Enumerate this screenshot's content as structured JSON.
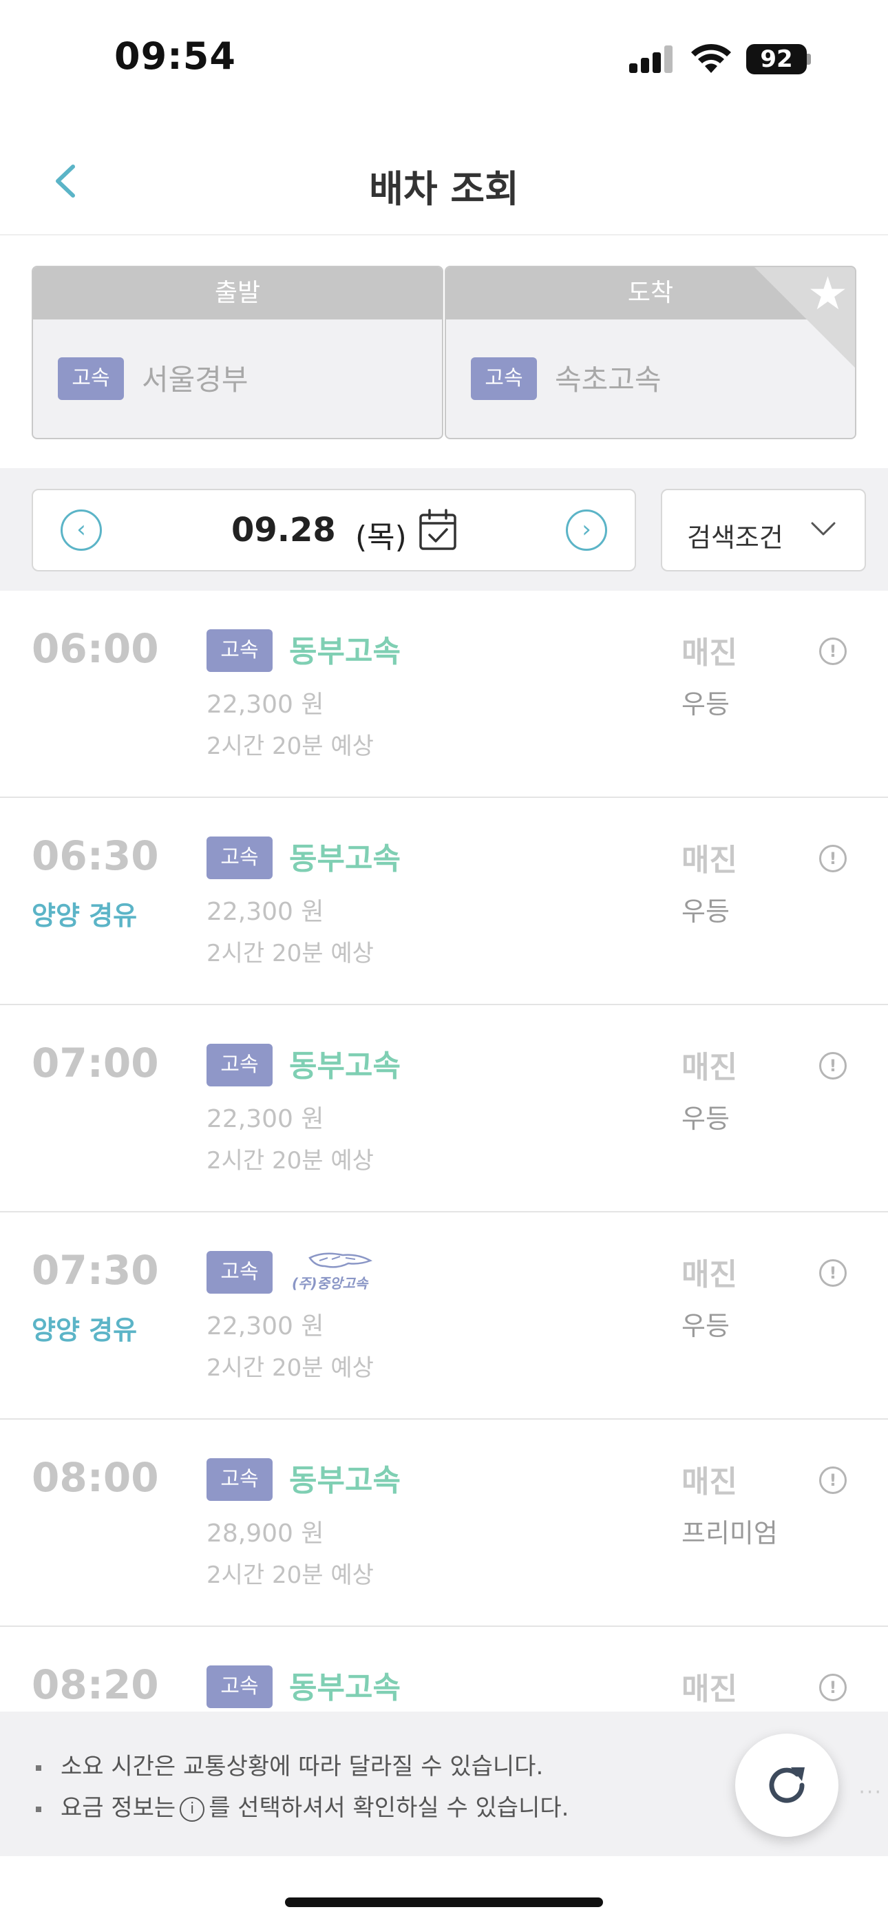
{
  "status_bar": {
    "time": "09:54",
    "battery": "92"
  },
  "header": {
    "title": "배차 조회"
  },
  "route": {
    "departure": {
      "label": "출발",
      "badge": "고속",
      "terminal": "서울경부"
    },
    "arrival": {
      "label": "도착",
      "badge": "고속",
      "terminal": "속초고속"
    }
  },
  "date_bar": {
    "date": "09.28",
    "weekday": "(목)",
    "search_label": "검색조건"
  },
  "buses": [
    {
      "time": "06:00",
      "via": "",
      "badge": "고속",
      "company": "동부고속",
      "price": "22,300 원",
      "duration": "2시간 20분 예상",
      "status": "매진",
      "grade": "우등"
    },
    {
      "time": "06:30",
      "via": "양양 경유",
      "badge": "고속",
      "company": "동부고속",
      "price": "22,300 원",
      "duration": "2시간 20분 예상",
      "status": "매진",
      "grade": "우등"
    },
    {
      "time": "07:00",
      "via": "",
      "badge": "고속",
      "company": "동부고속",
      "price": "22,300 원",
      "duration": "2시간 20분 예상",
      "status": "매진",
      "grade": "우등"
    },
    {
      "time": "07:30",
      "via": "양양 경유",
      "badge": "고속",
      "company": "(주)중앙고속",
      "price": "22,300 원",
      "duration": "2시간 20분 예상",
      "status": "매진",
      "grade": "우등"
    },
    {
      "time": "08:00",
      "via": "",
      "badge": "고속",
      "company": "동부고속",
      "price": "28,900 원",
      "duration": "2시간 20분 예상",
      "status": "매진",
      "grade": "프리미엄"
    },
    {
      "time": "08:20",
      "via": "",
      "badge": "고속",
      "company": "동부고속",
      "price": "",
      "duration": "",
      "status": "매진",
      "grade": ""
    }
  ],
  "notice": {
    "line1": "소요 시간은 교통상황에 따라 달라질 수 있습니다.",
    "line2_pre": "요금 정보는",
    "line2_post": "를 선택하셔서 확인하실 수 있습니다."
  }
}
